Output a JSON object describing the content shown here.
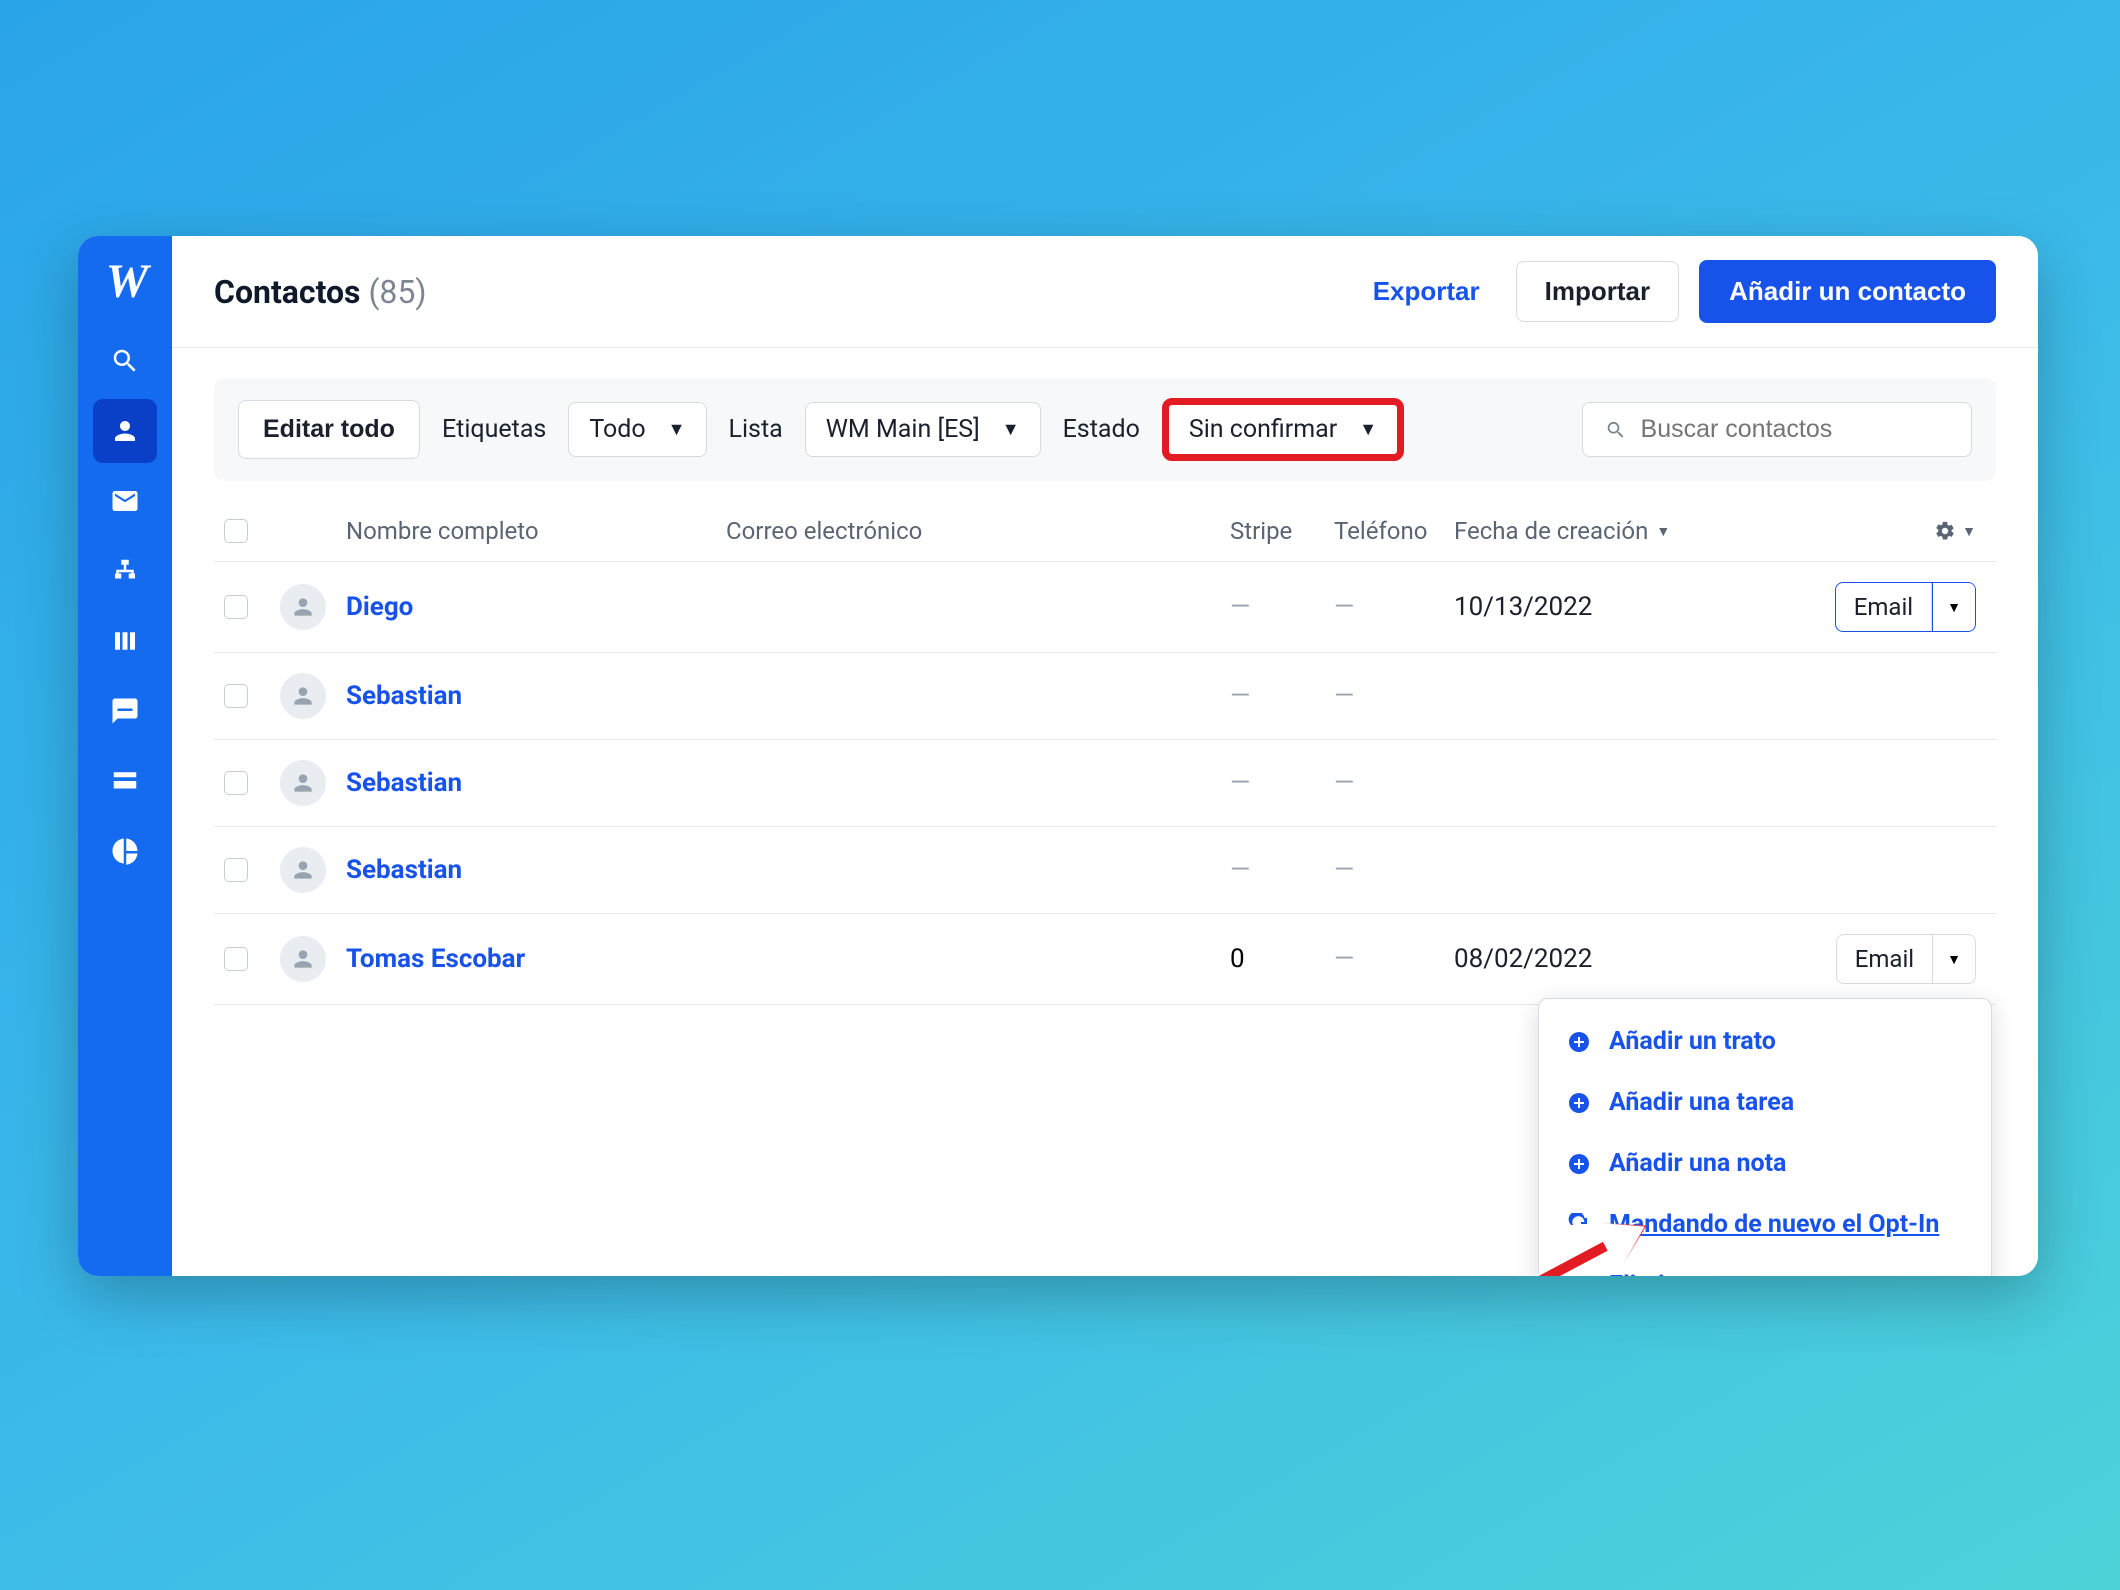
{
  "header": {
    "title": "Contactos",
    "count": "(85)",
    "export_label": "Exportar",
    "import_label": "Importar",
    "add_label": "Añadir un contacto"
  },
  "filters": {
    "edit_all": "Editar todo",
    "tags_label": "Etiquetas",
    "tags_value": "Todo",
    "list_label": "Lista",
    "list_value": "WM Main [ES]",
    "status_label": "Estado",
    "status_value": "Sin confirmar",
    "search_placeholder": "Buscar contactos"
  },
  "columns": {
    "name": "Nombre completo",
    "email": "Correo electrónico",
    "stripe": "Stripe",
    "phone": "Teléfono",
    "created": "Fecha de creación"
  },
  "rows": [
    {
      "name": "Diego",
      "stripe": "—",
      "phone": "—",
      "created": "10/13/2022",
      "action": "Email",
      "menu_open": true
    },
    {
      "name": "Sebastian",
      "stripe": "—",
      "phone": "—",
      "created": "",
      "action": ""
    },
    {
      "name": "Sebastian",
      "stripe": "—",
      "phone": "—",
      "created": "",
      "action": ""
    },
    {
      "name": "Sebastian",
      "stripe": "—",
      "phone": "—",
      "created": "",
      "action": ""
    },
    {
      "name": "Tomas Escobar",
      "stripe": "0",
      "phone": "—",
      "created": "08/02/2022",
      "action": "Email"
    }
  ],
  "menu": {
    "add_deal": "Añadir un trato",
    "add_task": "Añadir una tarea",
    "add_note": "Añadir una nota",
    "resend_optin": "Mandando de nuevo el Opt-In",
    "delete": "Eliminar contacto"
  },
  "email_button_label": "Email"
}
